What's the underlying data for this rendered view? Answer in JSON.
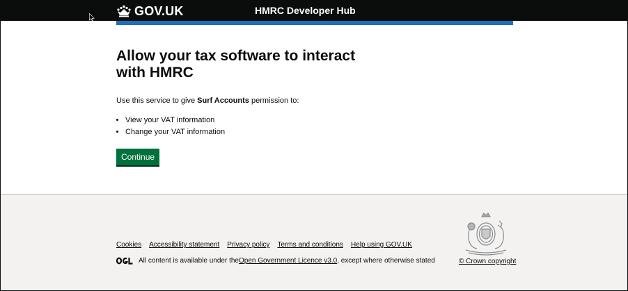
{
  "header": {
    "logo_text": "GOV.UK",
    "service_name": "HMRC Developer Hub"
  },
  "main": {
    "heading": "Allow your tax software to interact with HMRC",
    "intro_prefix": "Use this service to give ",
    "app_name": "Surf Accounts",
    "intro_suffix": " permission to:",
    "permissions": [
      "View your VAT information",
      "Change your VAT information"
    ],
    "continue_label": "Continue"
  },
  "footer": {
    "links": [
      "Cookies",
      "Accessibility statement",
      "Privacy policy",
      "Terms and conditions",
      "Help using GOV.UK"
    ],
    "licence_prefix": "All content is available under the ",
    "licence_link": "Open Government Licence v3.0",
    "licence_suffix": " , except where otherwise stated",
    "copyright": "© Crown copyright"
  },
  "colors": {
    "header_bg": "#0b0c0c",
    "accent_blue": "#1d70b8",
    "button_green": "#00703c",
    "footer_bg": "#f3f2f1"
  }
}
